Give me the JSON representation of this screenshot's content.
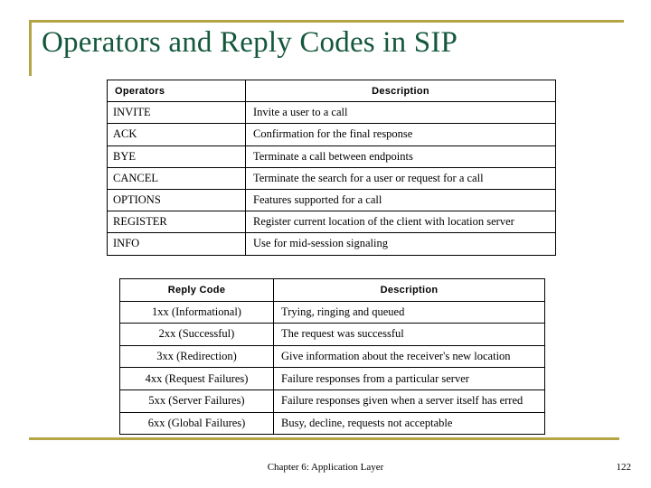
{
  "slide": {
    "title": "Operators and Reply Codes in SIP",
    "accent_color": "#b3a546",
    "title_color": "#14583c"
  },
  "operators_table": {
    "headers": {
      "col1": "Operators",
      "col2": "Description"
    },
    "rows": [
      {
        "operator": "INVITE",
        "description": "Invite a user to a call"
      },
      {
        "operator": "ACK",
        "description": "Confirmation for the final response"
      },
      {
        "operator": "BYE",
        "description": "Terminate a call between endpoints"
      },
      {
        "operator": "CANCEL",
        "description": "Terminate the search for a user or request for a call"
      },
      {
        "operator": "OPTIONS",
        "description": "Features supported for a call"
      },
      {
        "operator": "REGISTER",
        "description": "Register current location of the client with location server"
      },
      {
        "operator": "INFO",
        "description": "Use for mid-session signaling"
      }
    ]
  },
  "reply_codes_table": {
    "headers": {
      "col1": "Reply Code",
      "col2": "Description"
    },
    "rows": [
      {
        "code": "1xx (Informational)",
        "description": "Trying, ringing and queued"
      },
      {
        "code": "2xx (Successful)",
        "description": "The request was successful"
      },
      {
        "code": "3xx (Redirection)",
        "description": "Give information about the receiver's new location"
      },
      {
        "code": "4xx (Request Failures)",
        "description": "Failure responses from a particular server"
      },
      {
        "code": "5xx (Server Failures)",
        "description": "Failure responses given when a server itself has erred"
      },
      {
        "code": "6xx (Global Failures)",
        "description": "Busy, decline, requests not acceptable"
      }
    ]
  },
  "footer": {
    "chapter": "Chapter 6: Application Layer",
    "page_number": "122"
  }
}
